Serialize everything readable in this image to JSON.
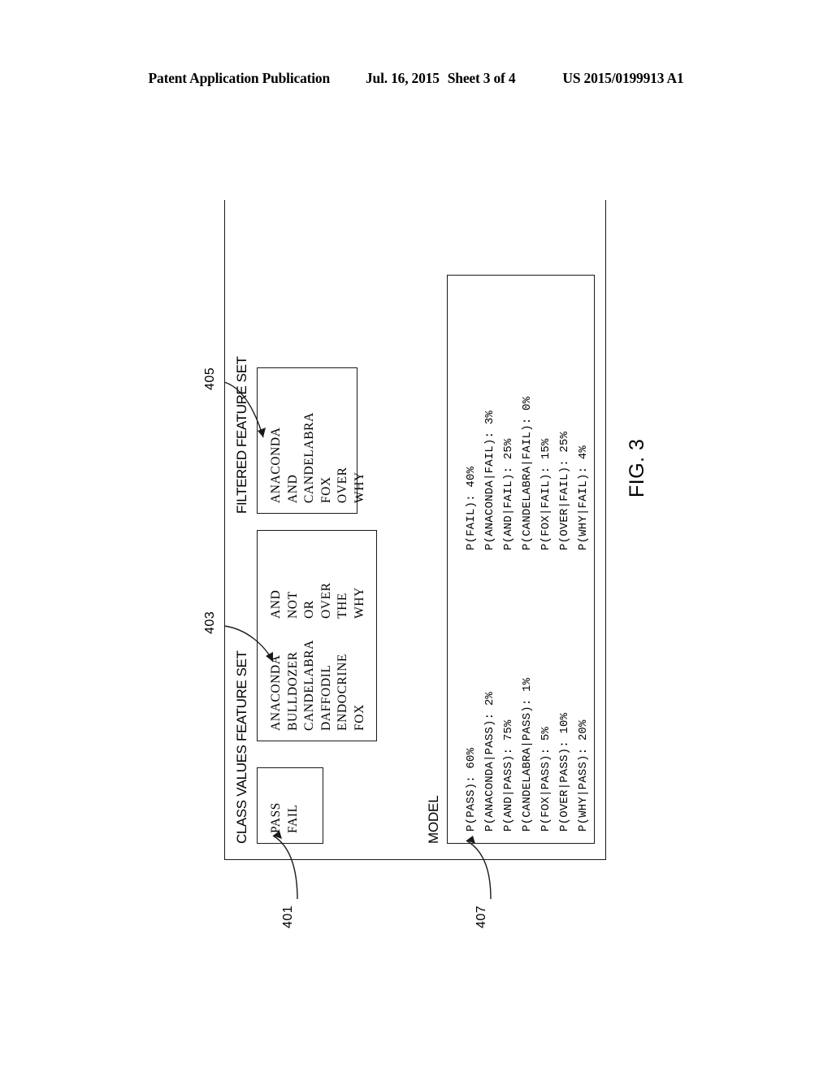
{
  "header": {
    "publication": "Patent Application Publication",
    "date": "Jul. 16, 2015",
    "sheet": "Sheet 3 of 4",
    "number": "US 2015/0199913 A1"
  },
  "figure": {
    "label": "FIG. 3",
    "sections": {
      "class_values": {
        "caption": "CLASS VALUES",
        "ref": "401",
        "items": [
          "PASS",
          "FAIL"
        ]
      },
      "feature_set": {
        "caption": "FEATURE SET",
        "ref": "403",
        "column1": [
          "ANACONDA",
          "BULLDOZER",
          "CANDELABRA",
          "DAFFODIL",
          "ENDOCRINE",
          "FOX"
        ],
        "column2": [
          "AND",
          "NOT",
          "OR",
          "OVER",
          "THE",
          "WHY"
        ]
      },
      "filtered_feature_set": {
        "caption": "FILTERED FEATURE SET",
        "ref": "405",
        "items": [
          "ANACONDA",
          "AND",
          "CANDELABRA",
          "FOX",
          "OVER",
          "WHY"
        ]
      },
      "model": {
        "caption": "MODEL",
        "ref": "407",
        "pass_column": [
          "P(PASS): 60%",
          "P(ANACONDA|PASS): 2%",
          "P(AND|PASS): 75%",
          "P(CANDELABRA|PASS): 1%",
          "P(FOX|PASS): 5%",
          "P(OVER|PASS): 10%",
          "P(WHY|PASS): 20%"
        ],
        "fail_column": [
          "P(FAIL): 40%",
          "P(ANACONDA|FAIL): 3%",
          "P(AND|FAIL): 25%",
          "P(CANDELABRA|FAIL): 0%",
          "P(FOX|FAIL): 15%",
          "P(OVER|FAIL): 25%",
          "P(WHY|FAIL): 4%"
        ]
      }
    }
  }
}
